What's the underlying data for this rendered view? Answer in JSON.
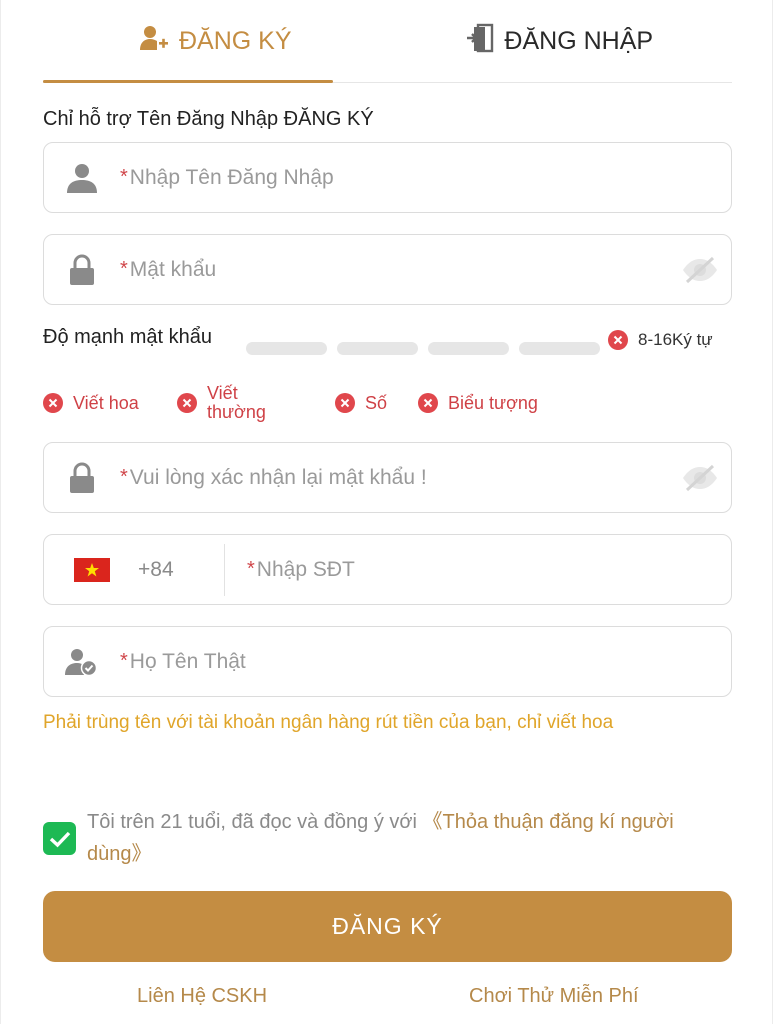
{
  "tabs": {
    "register_label": "ĐĂNG KÝ",
    "login_label": "ĐĂNG NHẬP"
  },
  "hint": "Chỉ hỗ trợ Tên Đăng Nhập ĐĂNG KÝ",
  "fields": {
    "required_mark": "*",
    "username_placeholder": "Nhập Tên Đăng Nhập",
    "password_placeholder": "Mật khẩu",
    "confirm_placeholder": "Vui lòng xác nhận lại mật khẩu !",
    "phone_code": "+84",
    "phone_placeholder": "Nhập SĐT",
    "realname_placeholder": "Họ Tên Thật"
  },
  "strength": {
    "label": "Độ mạnh mật khẩu",
    "level": 0,
    "bars_total": 4,
    "length_rule": "8-16Ký tự"
  },
  "rules": [
    {
      "label": "Viết hoa"
    },
    {
      "label": "Viết thường"
    },
    {
      "label": "Số"
    },
    {
      "label": "Biểu tượng"
    }
  ],
  "note": "Phải trùng tên với tài khoản ngân hàng rút tiền của bạn, chỉ viết hoa",
  "agree": {
    "checked": true,
    "text": "Tôi trên 21 tuổi, đã đọc và đồng ý với ",
    "link": "《Thỏa thuận đăng kí người dùng》"
  },
  "submit_label": "ĐĂNG KÝ",
  "footer": {
    "support": "Liên Hệ CSKH",
    "trial": "Chơi Thử Miễn Phí"
  },
  "colors": {
    "accent": "#c48d42",
    "error": "#d9464b",
    "warning": "#e0a52a",
    "checkbox": "#1db954"
  }
}
